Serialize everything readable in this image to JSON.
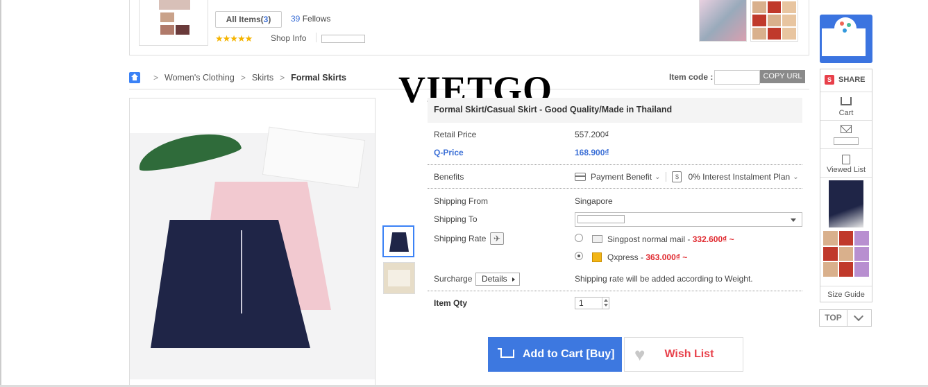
{
  "shop": {
    "all_items_label": "All Items(",
    "all_items_count": "3",
    "all_items_close": ")",
    "fellows_count": "39",
    "fellows_label": "Fellows",
    "stars": "★★★★★",
    "shop_info": "Shop Info"
  },
  "watermark": "VIETGO",
  "breadcrumb": {
    "items": [
      "Women's Clothing",
      "Skirts"
    ],
    "current": "Formal Skirts"
  },
  "item_code": {
    "label": "Item code :",
    "copy_button": "COPY URL"
  },
  "product": {
    "title": "Formal Skirt/Casual Skirt - Good Quality/Made in Thailand",
    "retail_price_label": "Retail Price",
    "retail_price": "557.200₫",
    "qprice_label": "Q-Price",
    "qprice": "168.900₫",
    "benefits_label": "Benefits",
    "payment_benefit": "Payment Benefit",
    "instalment_plan": "0% Interest Instalment Plan",
    "shipping_from_label": "Shipping From",
    "shipping_from": "Singapore",
    "shipping_to_label": "Shipping To",
    "shipping_rate_label": "Shipping Rate",
    "shipping_options": [
      {
        "name": "Singpost normal mail -",
        "price": "332.600₫ ~",
        "selected": false
      },
      {
        "name": "Qxpress -",
        "price": "363.000₫ ~",
        "selected": true
      }
    ],
    "surcharge_label": "Surcharge",
    "details_button": "Details",
    "surcharge_note": "Shipping rate will be added according to Weight.",
    "qty_label": "Item Qty",
    "qty_value": "1",
    "add_to_cart": "Add to Cart [Buy]",
    "wish_list": "Wish List"
  },
  "sidebar": {
    "share": "SHARE",
    "share_icon": "S",
    "cart": "Cart",
    "viewed_list": "Viewed List",
    "size_guide": "Size Guide",
    "top": "TOP"
  },
  "colors": {
    "accent_blue": "#3d78e0",
    "price_red": "#e0292f",
    "wish_red": "#e8404a"
  }
}
